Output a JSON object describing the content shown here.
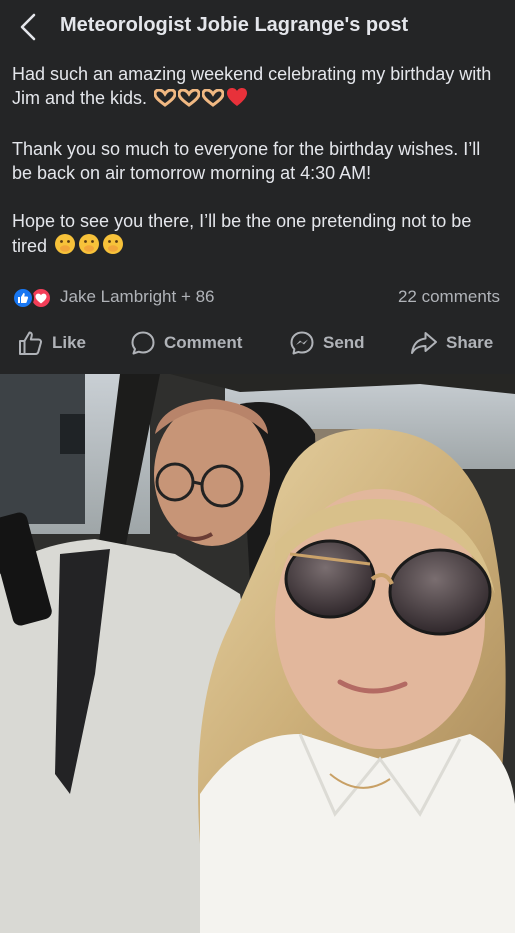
{
  "header": {
    "title": "Meteorologist Jobie Lagrange's post"
  },
  "post": {
    "paragraphs": [
      "Had such an amazing weekend celebrating my birthday with Jim and the kids.",
      "Thank you so much to everyone for the birthday wishes. I’ll be back on air tomorrow morning at 4:30 AM!",
      "Hope to see you there, I’ll be the one pretending not to be tired"
    ],
    "emojis_p1": [
      "heart-hands-emoji",
      "heart-hands-emoji",
      "heart-hands-emoji",
      "red-heart-emoji"
    ],
    "emojis_p3": [
      "face-peeking-emoji",
      "face-peeking-emoji",
      "face-peeking-emoji"
    ]
  },
  "meta": {
    "reactors": "Jake Lambright + 86",
    "comments": "22 comments",
    "reactions": [
      "like-icon",
      "love-icon"
    ]
  },
  "actions": {
    "like": "Like",
    "comment": "Comment",
    "send": "Send",
    "share": "Share"
  },
  "colors": {
    "background": "#242526",
    "text": "#e4e6eb",
    "secondary_text": "#b0b3b8",
    "like_blue": "#1877f2",
    "love_red": "#f33e58"
  }
}
